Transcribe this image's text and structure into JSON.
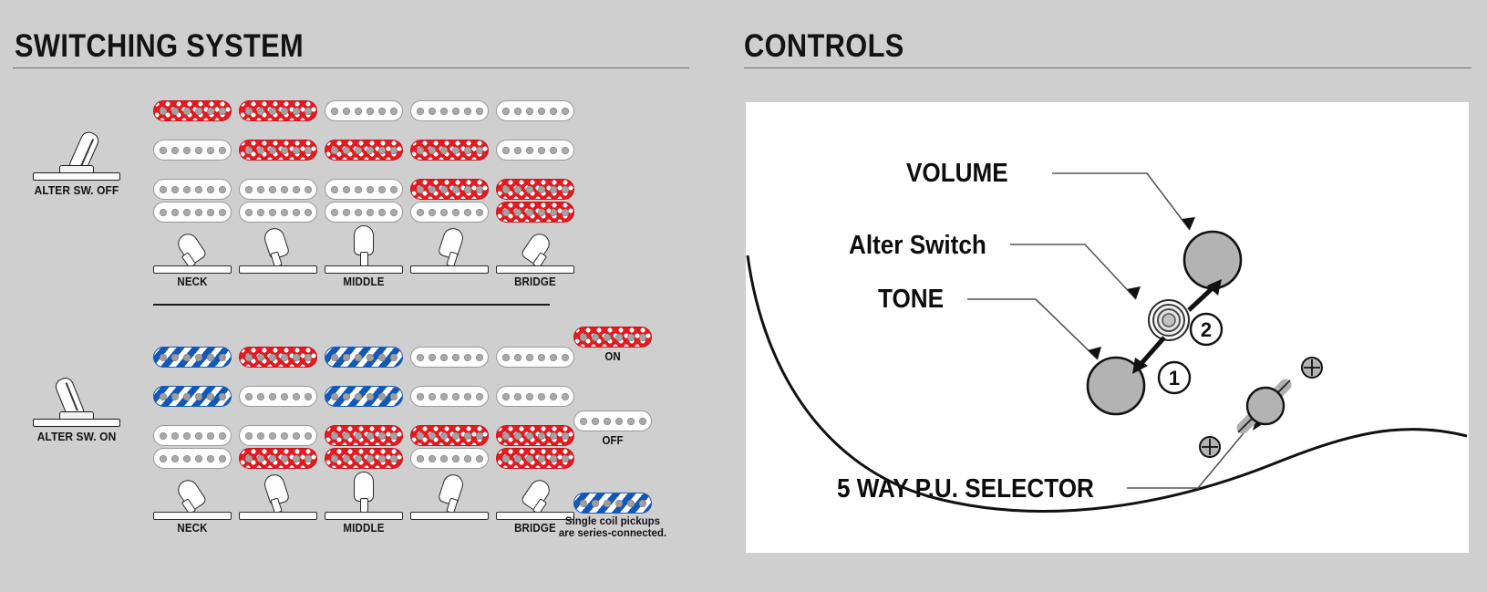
{
  "panels": {
    "left": {
      "title": "SWITCHING SYSTEM"
    },
    "right": {
      "title": "CONTROLS"
    }
  },
  "switching": {
    "rows": [
      {
        "alter_label": "ALTER SW. OFF",
        "toggle_state": "off",
        "positions": [
          {
            "label": "NECK",
            "lever": "p1"
          },
          {
            "label": "",
            "lever": "p2"
          },
          {
            "label": "MIDDLE",
            "lever": "p3"
          },
          {
            "label": "",
            "lever": "p4"
          },
          {
            "label": "BRIDGE",
            "lever": "p5"
          }
        ],
        "neck": [
          "red",
          "red",
          "off",
          "off",
          "off"
        ],
        "middle": [
          "off",
          "red",
          "red",
          "red",
          "off"
        ],
        "bridge_top": [
          "off",
          "off",
          "off",
          "red",
          "red"
        ],
        "bridge_bottom": [
          "off",
          "off",
          "off",
          "off",
          "red"
        ]
      },
      {
        "alter_label": "ALTER SW. ON",
        "toggle_state": "on",
        "positions": [
          {
            "label": "NECK",
            "lever": "p1"
          },
          {
            "label": "",
            "lever": "p2"
          },
          {
            "label": "MIDDLE",
            "lever": "p3"
          },
          {
            "label": "",
            "lever": "p4"
          },
          {
            "label": "BRIDGE",
            "lever": "p5"
          }
        ],
        "neck": [
          "blue",
          "red",
          "blue",
          "off",
          "off"
        ],
        "middle": [
          "blue",
          "off",
          "blue",
          "off",
          "off"
        ],
        "bridge_top": [
          "off",
          "off",
          "red",
          "red",
          "red"
        ],
        "bridge_bottom": [
          "off",
          "red",
          "red",
          "off",
          "red"
        ]
      }
    ],
    "legend": {
      "on_label": "ON",
      "off_label": "OFF",
      "note": "Single coil pickups\nare series-connected.",
      "on_style": "red",
      "off_style": "off",
      "note_style": "blue"
    }
  },
  "controls": {
    "labels": {
      "volume": "VOLUME",
      "alter_switch": "Alter Switch",
      "tone": "TONE",
      "selector": "5 WAY P.U. SELECTOR"
    },
    "markers": {
      "one": "1",
      "two": "2"
    }
  },
  "colors": {
    "background": "#cfcfcf",
    "pickup_on": "#e21b22",
    "pickup_series": "#1258b8",
    "pickup_off": "#fdfdfd",
    "ink": "#131313",
    "canvas": "#ffffff",
    "knob": "#b3b3b3"
  }
}
